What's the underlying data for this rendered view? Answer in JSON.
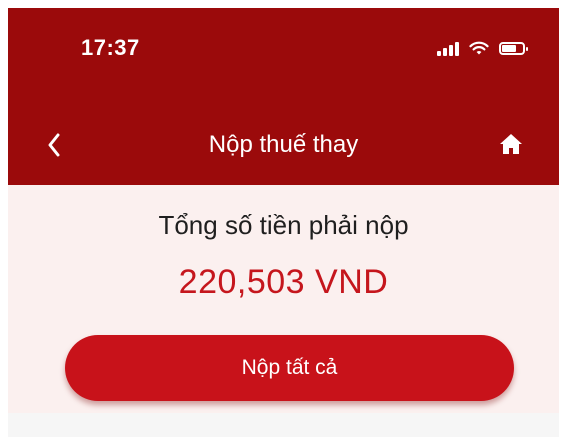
{
  "status_bar": {
    "time": "17:37",
    "icons": [
      "cellular-signal-icon",
      "wifi-icon",
      "battery-icon"
    ]
  },
  "nav": {
    "title": "Nộp thuế thay",
    "back_icon": "chevron-left-icon",
    "home_icon": "home-icon"
  },
  "summary": {
    "label": "Tổng số tiền phải nộp",
    "amount": "220,503 VND"
  },
  "actions": {
    "pay_all_label": "Nộp tất cả"
  },
  "colors": {
    "header_bg": "#9b0a0b",
    "content_bg": "#fbf0ef",
    "accent_red": "#c5161d",
    "button_bg": "#c8121a"
  }
}
